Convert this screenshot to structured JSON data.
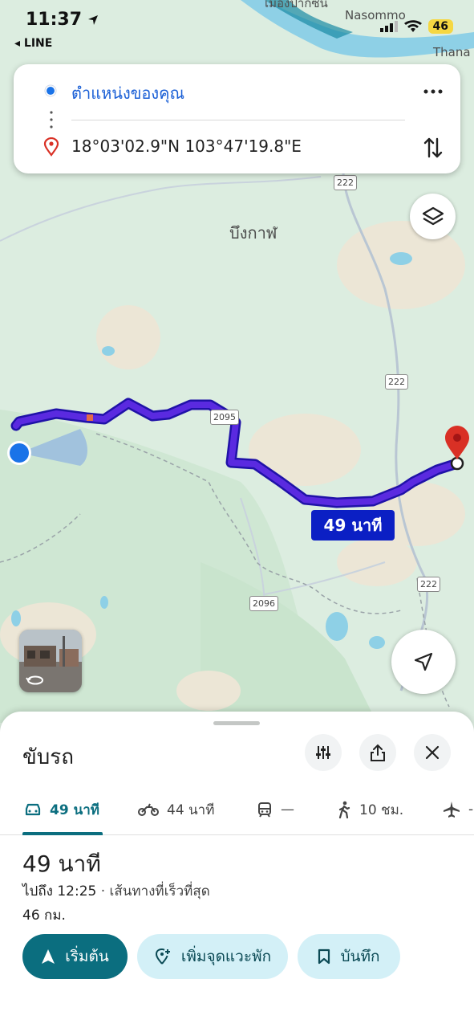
{
  "status_bar": {
    "time": "11:37",
    "back_app": "◂ LINE",
    "battery": "46"
  },
  "search": {
    "origin": "ตำแหน่งของคุณ",
    "destination": "18°03'02.9\"N 103°47'19.8\"E"
  },
  "map": {
    "place_label": "บึงกาฬ",
    "top_labels": [
      "Nasommo",
      "Thana",
      "เมืองปากซัน"
    ],
    "road_numbers": [
      "222",
      "222",
      "2095",
      "2096",
      "222"
    ],
    "eta_bubble": "49 นาที"
  },
  "sheet": {
    "title": "ขับรถ",
    "modes": [
      {
        "icon": "car-icon",
        "label": "49 นาที"
      },
      {
        "icon": "motorcycle-icon",
        "label": "44 นาที"
      },
      {
        "icon": "transit-icon",
        "label": "—"
      },
      {
        "icon": "walk-icon",
        "label": "10 ชม."
      },
      {
        "icon": "plane-icon",
        "label": "-"
      }
    ],
    "duration": "49 นาที",
    "arrive": "ไปถึง 12:25",
    "route_desc": " · เส้นทางที่เร็วที่สุด",
    "distance": "46 กม.",
    "start_label": "เริ่มต้น",
    "add_stop_label": "เพิ่มจุดแวะพัก",
    "save_label": "บันทึก"
  },
  "colors": {
    "route": "#3d1fd6",
    "accent": "#0b6e7f",
    "eta_bubble": "#0b1fc4",
    "pin": "#d93025"
  }
}
